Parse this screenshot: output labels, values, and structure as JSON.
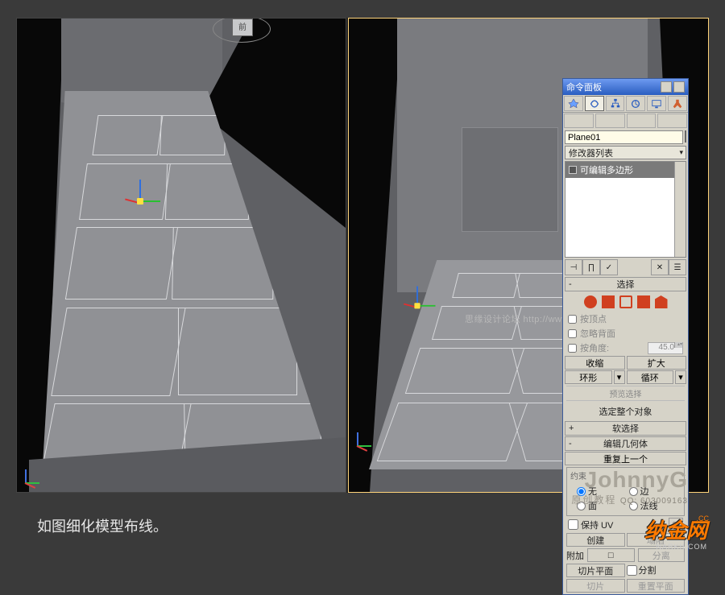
{
  "viewcube": {
    "front": "前"
  },
  "panel": {
    "title": "命令面板",
    "object_name": "Plane01",
    "modifier_list": "修改器列表",
    "stack_item": "可编辑多边形",
    "rollouts": {
      "selection": "选择",
      "soft_selection": "软选择",
      "edit_geometry": "编辑几何体"
    },
    "selection": {
      "by_vertex": "按顶点",
      "ignore_backfacing": "忽略背面",
      "by_angle": "按角度:",
      "angle_value": "45.0",
      "shrink": "收缩",
      "grow": "扩大",
      "ring": "环形",
      "loop": "循环",
      "preview_label": "预览选择",
      "select_whole": "选定整个对象"
    },
    "edit_geom": {
      "repeat_last": "重复上一个",
      "constraints": "约束",
      "none": "无",
      "edge": "边",
      "face": "面",
      "normal": "法线",
      "preserve_uv": "保持 UV",
      "preserve_uv_btn": "□",
      "create": "创建",
      "collapse": "塌陷",
      "attach": "附加",
      "detach": "分离",
      "slice_plane": "切片平面",
      "split": "分割",
      "slice": "切片",
      "reset_plane": "重置平面"
    }
  },
  "watermark_center": "思缘设计论坛 http://www.MISSYUAN.com",
  "author": {
    "name": "JohnnyG",
    "sub": "原创教程",
    "qq": "QQ: 603009163"
  },
  "caption": "如图细化模型布线。",
  "logo": {
    "cn": "纳金网",
    "cc": ".CC",
    "en": "NARKII.COM"
  }
}
